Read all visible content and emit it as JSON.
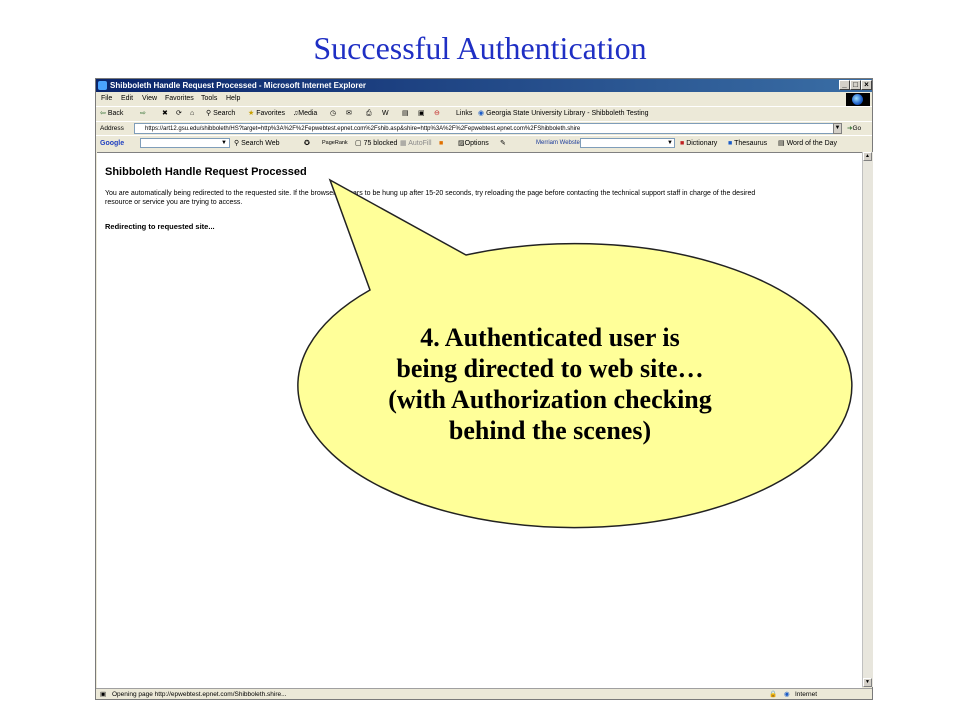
{
  "slide": {
    "title": "Successful Authentication"
  },
  "browser": {
    "window_title": "Shibboleth Handle Request Processed - Microsoft Internet Explorer",
    "menu": [
      "File",
      "Edit",
      "View",
      "Favorites",
      "Tools",
      "Help"
    ],
    "toolbar": {
      "back": "Back",
      "search": "Search",
      "favorites": "Favorites",
      "media": "Media",
      "links_label": "Links",
      "link_item": "Georgia State University Library - Shibboleth Testing"
    },
    "address": {
      "label": "Address",
      "url": "https://art12.gsu.edu/shibboleth/HS?target=http%3A%2F%2Fepwebtest.epnet.com%2Fshib.asp&shire=http%3A%2F%2Fepwebtest.epnet.com%2FShibboleth.shire",
      "go_label": "Go"
    },
    "google_toolbar": {
      "logo": "Google",
      "search_web": "Search Web",
      "pagerank": "PageRank",
      "blocked": "75 blocked",
      "autofill": "AutoFill",
      "options": "Options",
      "dictionary": "Dictionary",
      "thesaurus": "Thesaurus",
      "word_of_day": "Word of the Day"
    },
    "status": {
      "text": "Opening page http://epwebtest.epnet.com/Shibboleth.shire...",
      "zone": "Internet"
    }
  },
  "page": {
    "heading": "Shibboleth Handle Request Processed",
    "body_line1": "You are automatically being redirected to the requested site. If the browser appears to be hung up after 15-20 seconds, try reloading the page before contacting the technical support staff in charge of the desired",
    "body_line2": "resource or service you are trying to access.",
    "redirecting": "Redirecting to requested site..."
  },
  "callout": {
    "line1": "4. Authenticated user is",
    "line2": "being directed to web site…",
    "line3": "(with Authorization checking",
    "line4": "behind the scenes)",
    "fill_color": "#ffff99"
  },
  "colors": {
    "title_blue": "#1f2fc4",
    "titlebar_blue": "#0a246a"
  }
}
